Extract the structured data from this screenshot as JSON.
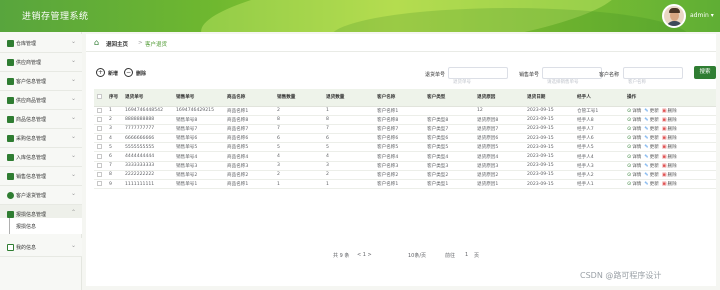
{
  "app": {
    "title": "进销存管理系统",
    "user": "admin ▾"
  },
  "sidebar": {
    "items": [
      {
        "label": "仓库管理",
        "icon": "grid-icon"
      },
      {
        "label": "供应商管理",
        "icon": "chat-icon"
      },
      {
        "label": "客户信息管理",
        "icon": "square-icon"
      },
      {
        "label": "供应商品管理",
        "icon": "square-icon"
      },
      {
        "label": "商品信息管理",
        "icon": "square-icon"
      },
      {
        "label": "采购信息管理",
        "icon": "grid-icon"
      },
      {
        "label": "入库信息管理",
        "icon": "send-icon"
      },
      {
        "label": "销售信息管理",
        "icon": "truck-icon"
      },
      {
        "label": "客户退货管理",
        "icon": "pin-icon"
      },
      {
        "label": "报损信息管理",
        "icon": "grid-icon"
      }
    ],
    "sub_item": "报损信息",
    "last_item": {
      "label": "我的信息",
      "icon": "window-icon"
    }
  },
  "breadcrumb": {
    "home": "退回主页",
    "sep": ">",
    "current": "客户退货"
  },
  "toolbar": {
    "add": "新增",
    "delete": "删除"
  },
  "filters": {
    "f1_label": "退货单号",
    "f1_placeholder": "退货单号",
    "f2_label": "销售单号",
    "f2_placeholder": "请选择销售单号",
    "f3_label": "客户名称",
    "f3_placeholder": "客户名称",
    "search": "搜索"
  },
  "table": {
    "headers": [
      "序号",
      "退货单号",
      "销售单号",
      "商品名称",
      "销售数量",
      "退货数量",
      "客户名称",
      "客户类型",
      "退货原因",
      "退货日期",
      "经手人",
      "操作"
    ],
    "rows": [
      [
        "1",
        "1694746448542",
        "1694746429215",
        "商品名称1",
        "2",
        "1",
        "客户名称1",
        "",
        "12",
        "2023-09-15",
        "仓管工号1"
      ],
      [
        "2",
        "8888888888",
        "销售单号8",
        "商品名称8",
        "8",
        "8",
        "客户名称8",
        "客户类型8",
        "退货原因8",
        "2023-09-15",
        "经手人8"
      ],
      [
        "3",
        "7777777777",
        "销售单号7",
        "商品名称7",
        "7",
        "7",
        "客户名称7",
        "客户类型7",
        "退货原因7",
        "2023-09-15",
        "经手人7"
      ],
      [
        "4",
        "6666666666",
        "销售单号6",
        "商品名称6",
        "6",
        "6",
        "客户名称6",
        "客户类型6",
        "退货原因6",
        "2023-09-15",
        "经手人6"
      ],
      [
        "5",
        "5555555555",
        "销售单号5",
        "商品名称5",
        "5",
        "5",
        "客户名称5",
        "客户类型5",
        "退货原因5",
        "2023-09-15",
        "经手人5"
      ],
      [
        "6",
        "4444444444",
        "销售单号4",
        "商品名称4",
        "4",
        "4",
        "客户名称4",
        "客户类型4",
        "退货原因4",
        "2023-09-15",
        "经手人4"
      ],
      [
        "7",
        "3333333333",
        "销售单号3",
        "商品名称3",
        "3",
        "3",
        "客户名称3",
        "客户类型3",
        "退货原因3",
        "2023-09-15",
        "经手人3"
      ],
      [
        "8",
        "2222222222",
        "销售单号2",
        "商品名称2",
        "2",
        "2",
        "客户名称2",
        "客户类型2",
        "退货原因2",
        "2023-09-15",
        "经手人2"
      ],
      [
        "9",
        "1111111111",
        "销售单号1",
        "商品名称1",
        "1",
        "1",
        "客户名称1",
        "客户类型1",
        "退货原因1",
        "2023-09-15",
        "经手人1"
      ]
    ],
    "ops": {
      "view": "详情",
      "edit": "更新",
      "del": "删除"
    }
  },
  "pagination": {
    "total": "共 9 条",
    "prev": "< 1 >",
    "page": "1",
    "per_page": "10条/页",
    "goto": "前往",
    "goto_page": "1",
    "page_unit": "页"
  },
  "watermark": "CSDN @路可程序设计"
}
